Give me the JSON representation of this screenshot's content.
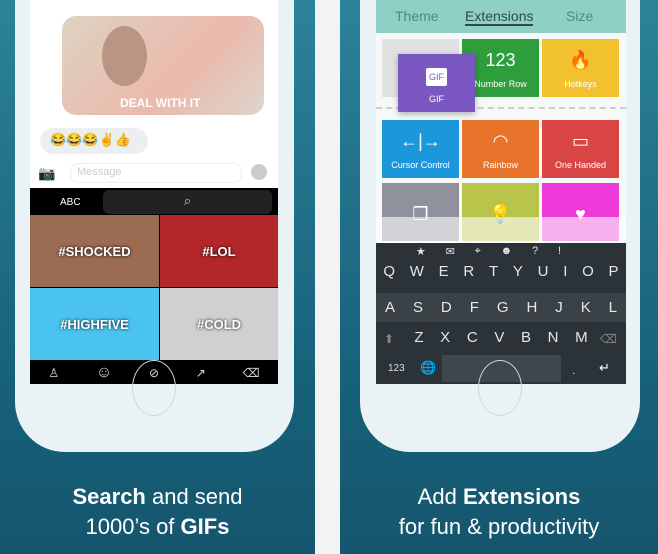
{
  "left": {
    "bubble_caption": "DEAL WITH IT",
    "emoji_message": "😂😂😂✌👍",
    "message_placeholder": "Message",
    "abc_label": "ABC",
    "gifs": [
      "#SHOCKED",
      "#LOL",
      "#HIGHFIVE",
      "#COLD"
    ],
    "bottom_icons": [
      "person-icon",
      "smiley-icon",
      "clock-icon",
      "trending-icon",
      "backspace-icon"
    ],
    "caption_bold1": "Search",
    "caption_rest1": " and send",
    "caption_line2": "1000’s of ",
    "caption_bold2": "GIFs"
  },
  "right": {
    "tabs": [
      "Theme",
      "Extensions",
      "Size"
    ],
    "active_tab": "Extensions",
    "drag_tile": {
      "label": "GIF",
      "icon": "GIF",
      "color": "#7b57c2"
    },
    "tiles": [
      {
        "label": "Number Row",
        "icon": "123",
        "color": "#2e9e3c"
      },
      {
        "label": "Hotkeys",
        "icon": "🔥",
        "color": "#f2c22e"
      },
      {
        "label": "Cursor Control",
        "icon": "←|→",
        "color": "#1d97dc"
      },
      {
        "label": "Rainbow",
        "icon": "◠",
        "color": "#e8732a"
      },
      {
        "label": "One Handed",
        "icon": "▭",
        "color": "#d94444"
      },
      {
        "label": "",
        "icon": "❐",
        "color": "#8f929c"
      },
      {
        "label": "",
        "icon": "💡",
        "color": "#b8c54a"
      },
      {
        "label": "",
        "icon": "♥",
        "color": "#ee3ad9"
      }
    ],
    "symbols": [
      "★",
      "✉",
      "⌖",
      "☻",
      "?",
      "!"
    ],
    "row1": [
      "Q",
      "W",
      "E",
      "R",
      "T",
      "Y",
      "U",
      "I",
      "O",
      "P"
    ],
    "row2": [
      "A",
      "S",
      "D",
      "F",
      "G",
      "H",
      "J",
      "K",
      "L"
    ],
    "row3": [
      "Z",
      "X",
      "C",
      "V",
      "B",
      "N",
      "M"
    ],
    "num_key": "123",
    "period_key": ".",
    "caption_line1": "Add ",
    "caption_bold1": "Extensions",
    "caption_line2": "for fun & productivity"
  }
}
